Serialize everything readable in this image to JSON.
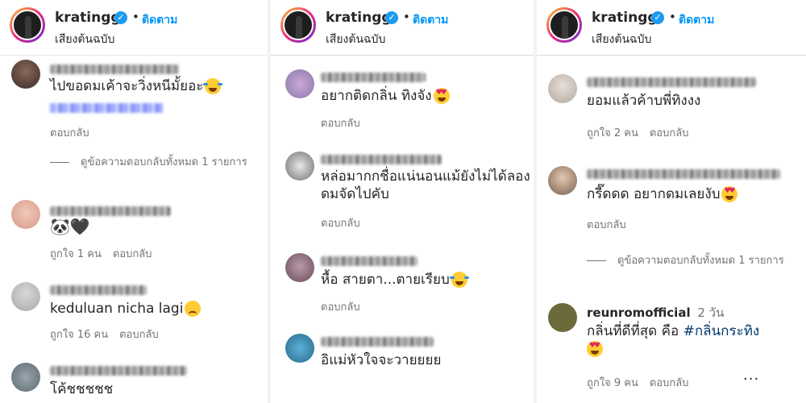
{
  "panels": [
    {
      "header": {
        "username": "kratingg",
        "follow": "ติดตาม",
        "subtitle": "เสียงต้นฉบับ",
        "sep": "•"
      },
      "comments": [
        {
          "text": "ไปขอดมเค้าจะวิ่งหนีมั้ยอะ",
          "emoji": "tears",
          "reply": "ตอบกลับ"
        },
        {
          "view_replies": "ดูข้อความตอบกลับทั้งหมด 1 รายการ"
        },
        {
          "text": "🐼🖤",
          "likes": "ถูกใจ 1 คน",
          "reply": "ตอบกลับ"
        },
        {
          "text": "keduluan nicha lagi",
          "emoji": "sad",
          "likes": "ถูกใจ 16 คน",
          "reply": "ตอบกลับ"
        },
        {
          "text": "โค้ชชชชช"
        }
      ]
    },
    {
      "header": {
        "username": "kratingg",
        "follow": "ติดตาม",
        "subtitle": "เสียงต้นฉบับ",
        "sep": "•"
      },
      "comments": [
        {
          "text": "อยากติดกลิ่น ทิงจัง",
          "emoji": "heart-eyes",
          "reply": "ตอบกลับ"
        },
        {
          "text": "หล่อมากกชื่อแน่นอนแม้ยังไม่ได้ลองดมจัดไปคับ",
          "reply": "ตอบกลับ"
        },
        {
          "text": "หื้อ สายตา...ตายเรียบ",
          "emoji": "tears",
          "reply": "ตอบกลับ"
        },
        {
          "text": "อิแม่หัวใจจะวายยยย"
        }
      ]
    },
    {
      "header": {
        "username": "kratingg",
        "follow": "ติดตาม",
        "subtitle": "เสียงต้นฉบับ",
        "sep": "•"
      },
      "comments": [
        {
          "text": "ยอมแล้วค้าบพี่ทิงงง",
          "likes": "ถูกใจ 2 คน",
          "reply": "ตอบกลับ"
        },
        {
          "text": "กรี๊ดดด อยากดมเลยงับ",
          "emoji": "heart-eyes",
          "reply": "ตอบกลับ"
        },
        {
          "view_replies": "ดูข้อความตอบกลับทั้งหมด 1 รายการ"
        },
        {
          "username": "reunromofficial",
          "time": "2 วัน",
          "text_plain": "กลิ่นที่ดีที่สุด คือ",
          "hashtag": "#กลิ่นกระทิง",
          "emoji": "heart-eyes",
          "likes": "ถูกใจ 9 คน",
          "reply": "ตอบกลับ",
          "more": "···"
        }
      ]
    }
  ],
  "colors": {
    "link": "#0095f6",
    "muted": "#737373",
    "text": "#262626",
    "verified": "#1d9bf0"
  },
  "icons": {
    "verified": "verified-badge-icon",
    "more": "more-options-icon"
  }
}
